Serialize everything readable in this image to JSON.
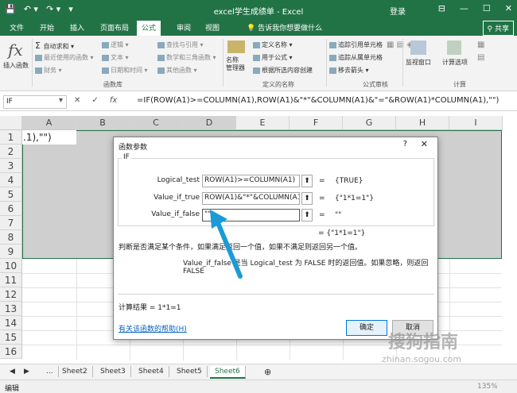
{
  "titlebar": {
    "title": "excel学生成绩单 - Excel",
    "login": "登录",
    "quick_access": [
      "💾",
      "↶ ▾",
      "↷ ▾",
      "▾"
    ],
    "window_buttons": [
      "⊟",
      "—",
      "☐",
      "✕"
    ]
  },
  "tabs": [
    "文件",
    "开始",
    "插入",
    "页面布局",
    "公式",
    "审阅",
    "视图"
  ],
  "active_tab": "公式",
  "tell_me": "告诉我你想要做什么",
  "share": "共享",
  "ribbon": {
    "insert_function": "插入函数",
    "autosum": "自动求和 ▾",
    "recent": "最近使用的函数 ▾",
    "finance": "财务 ▾",
    "logic": "逻辑 ▾",
    "text": "文本 ▾",
    "datetime": "日期和时间 ▾",
    "lookup": "查找与引用 ▾",
    "math": "数学和三角函数 ▾",
    "other": "其他函数 ▾",
    "group_library": "函数库",
    "name_manager": "名称\n管理器",
    "define_name": "定义名称 ▾",
    "use_in_formula": "用于公式 ▾",
    "create_from_sel": "根据所选内容创建",
    "group_names": "定义的名称",
    "trace_prec": "追踪引用单元格",
    "trace_dep": "追踪从属单元格",
    "remove_arrows": "移去箭头 ▾",
    "group_audit": "公式审核",
    "watch": "监视窗口",
    "calc_options": "计算选项",
    "group_calc": "计算"
  },
  "formula_bar": {
    "name_box": "IF",
    "icons": [
      "▾",
      "✕",
      "✓",
      "fx"
    ],
    "formula": "=IF(ROW(A1)>=COLUMN(A1),ROW(A1)&\"*\"&COLUMN(A1)&\"=\"&ROW(A1)*COLUMN(A1),\"\")"
  },
  "grid": {
    "columns": [
      "A",
      "B",
      "C",
      "D",
      "E",
      "F",
      "G",
      "H",
      "I"
    ],
    "rows": [
      "1",
      "2",
      "3",
      "4",
      "5",
      "6",
      "7",
      "8",
      "9",
      "10",
      "11",
      "12",
      "13",
      "14",
      "15",
      "16"
    ],
    "a1_text": ".1),\"\")"
  },
  "sheets": [
    "Sheet2",
    "Sheet3",
    "Sheet4",
    "Sheet5",
    "Sheet6"
  ],
  "active_sheet": "Sheet6",
  "sheet_nav": [
    "◀",
    "▶",
    "..."
  ],
  "add_sheet": "⊕",
  "status": {
    "mode": "编辑",
    "zoom": "135%"
  },
  "dialog": {
    "title": "函数参数",
    "help": "?",
    "close": "✕",
    "func": "IF",
    "args": [
      {
        "label": "Logical_test",
        "value": "ROW(A1)>=COLUMN(A1)",
        "result": "{TRUE}"
      },
      {
        "label": "Value_if_true",
        "value": "ROW(A1)&\"*\"&COLUMN(A1)",
        "result": "{\"1*1=1\"}"
      },
      {
        "label": "Value_if_false",
        "value": "\"\"",
        "result": "\"\""
      }
    ],
    "eq": "=",
    "function_result": "= {\"1*1=1\"}",
    "description": "判断是否满足某个条件，如果满足返回一个值，如果不满足则返回另一个值。",
    "arg_description": "Value_if_false  是当 Logical_test 为 FALSE 时的返回值。如果忽略，则返回 FALSE",
    "calc_result": "计算结果 =   1*1=1",
    "help_link": "有关该函数的帮助(H)",
    "ok": "确定",
    "cancel": "取消"
  },
  "watermark": {
    "text": "搜狗指南",
    "url": "zhinan.sogou.com"
  },
  "colors": {
    "brand": "#217346",
    "arrow": "#1a9bd7",
    "link": "#0563c1"
  }
}
